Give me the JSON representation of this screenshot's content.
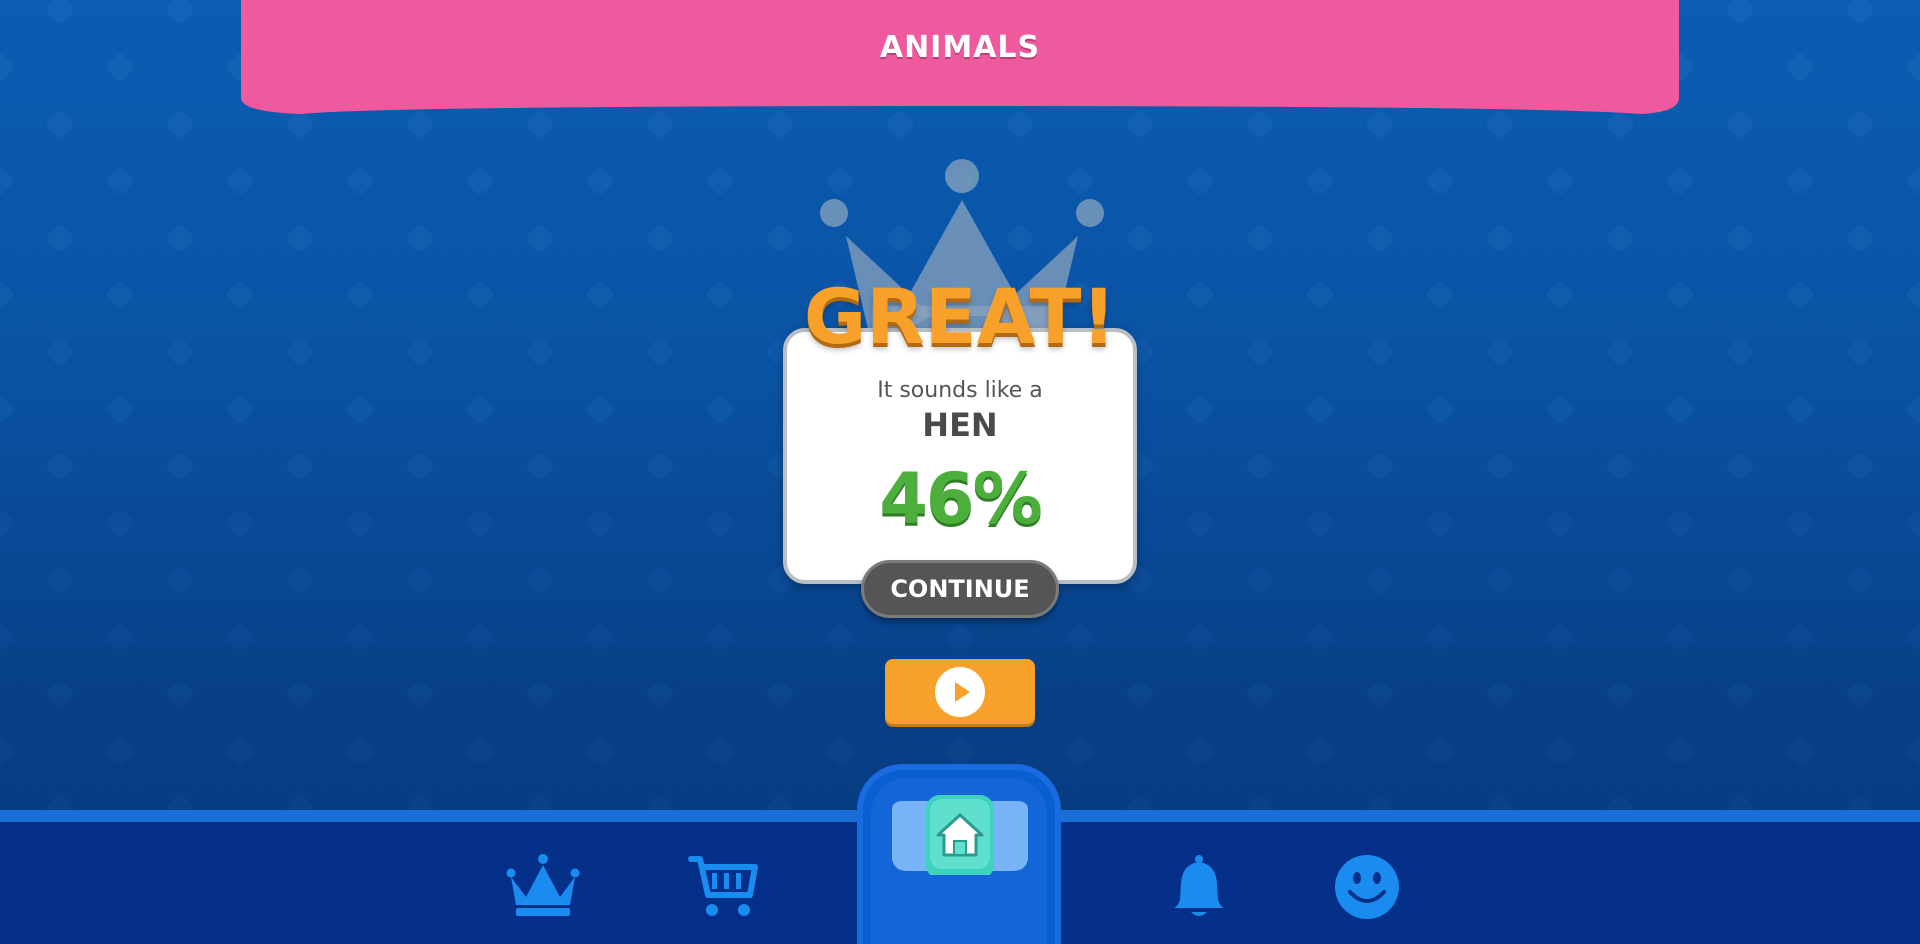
{
  "banner": {
    "title": "ANIMALS",
    "color": "#ef5a9e"
  },
  "result": {
    "headline": "GREAT!",
    "subtitle": "It sounds like a",
    "animal": "HEN",
    "score": "46%",
    "continue_label": "CONTINUE"
  },
  "play_button": {
    "icon": "play-icon",
    "color": "#f8a12a"
  },
  "nav": {
    "items": [
      {
        "icon": "crown-icon"
      },
      {
        "icon": "cart-icon"
      },
      {
        "icon": "home-icon"
      },
      {
        "icon": "bell-icon"
      },
      {
        "icon": "smiley-icon"
      }
    ],
    "accent": "#1a8cf0"
  },
  "colors": {
    "background": "#0a55a8",
    "headline": "#f8a12a",
    "score": "#4caf3c",
    "continue_bg": "#555555"
  }
}
